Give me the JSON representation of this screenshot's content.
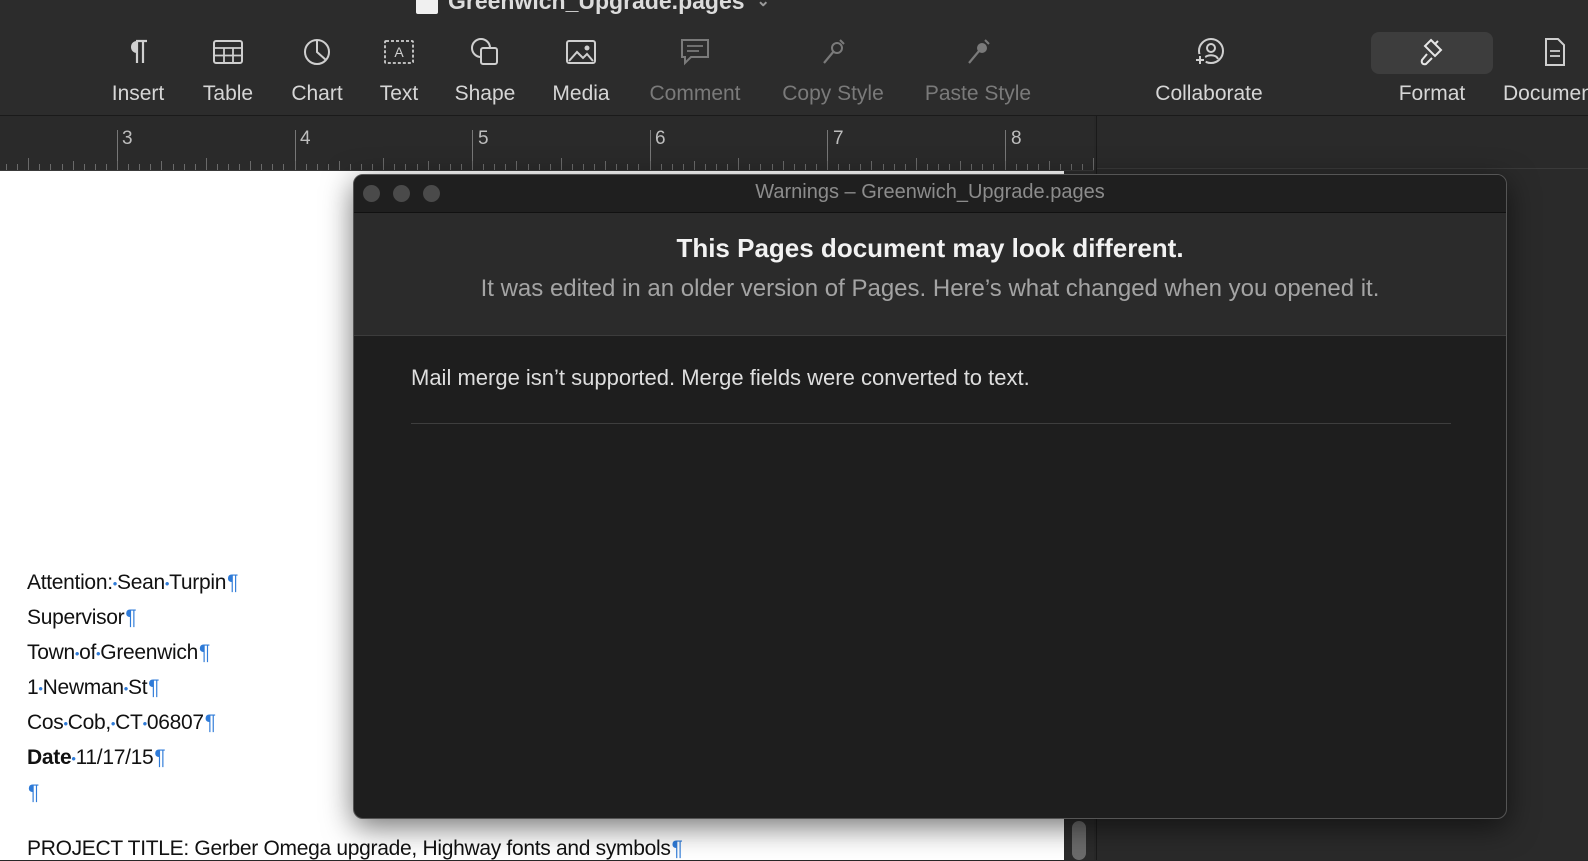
{
  "window": {
    "doc_title": "Greenwich_Upgrade.pages"
  },
  "toolbar": {
    "buttons": [
      {
        "label": "Insert",
        "icon": "pilcrow-icon"
      },
      {
        "label": "Table",
        "icon": "table-icon"
      },
      {
        "label": "Chart",
        "icon": "chart-icon"
      },
      {
        "label": "Text",
        "icon": "text-box-icon"
      },
      {
        "label": "Shape",
        "icon": "shape-icon"
      },
      {
        "label": "Media",
        "icon": "photo-icon"
      },
      {
        "label": "Comment",
        "icon": "comment-icon",
        "disabled": true
      },
      {
        "label": "Copy Style",
        "icon": "copy-style-icon",
        "disabled": true
      },
      {
        "label": "Paste Style",
        "icon": "paste-style-icon",
        "disabled": true
      },
      {
        "label": "Collaborate",
        "icon": "collaborate-icon"
      },
      {
        "label": "Format",
        "icon": "paintbrush-icon",
        "active": true
      },
      {
        "label": "Document",
        "icon": "document-icon"
      }
    ]
  },
  "ruler": {
    "numbers": [
      "3",
      "4",
      "5",
      "6",
      "7",
      "8"
    ]
  },
  "document": {
    "attention_label": "Attention:",
    "attention_name_1": "Sean",
    "attention_name_2": "Turpin",
    "title_line": "Supervisor",
    "org_1": "Town",
    "org_2": "of",
    "org_3": "Greenwich",
    "addr_1": "1",
    "addr_2": "Newman",
    "addr_3": "St",
    "city_1": "Cos",
    "city_2": "Cob,",
    "city_3": "CT",
    "city_4": "06807",
    "date_label": "Date",
    "date_value": "11/17/15",
    "project_line": "PROJECT TITLE: Gerber Omega upgrade, Highway fonts and symbols",
    "pilcrow": "¶"
  },
  "warnings": {
    "window_title": "Warnings – Greenwich_Upgrade.pages",
    "headline": "This Pages document may look different.",
    "subtitle": "It was edited in an older version of Pages. Here’s what changed when you opened it.",
    "items": [
      "Mail merge isn’t supported. Merge fields were converted to text."
    ]
  }
}
